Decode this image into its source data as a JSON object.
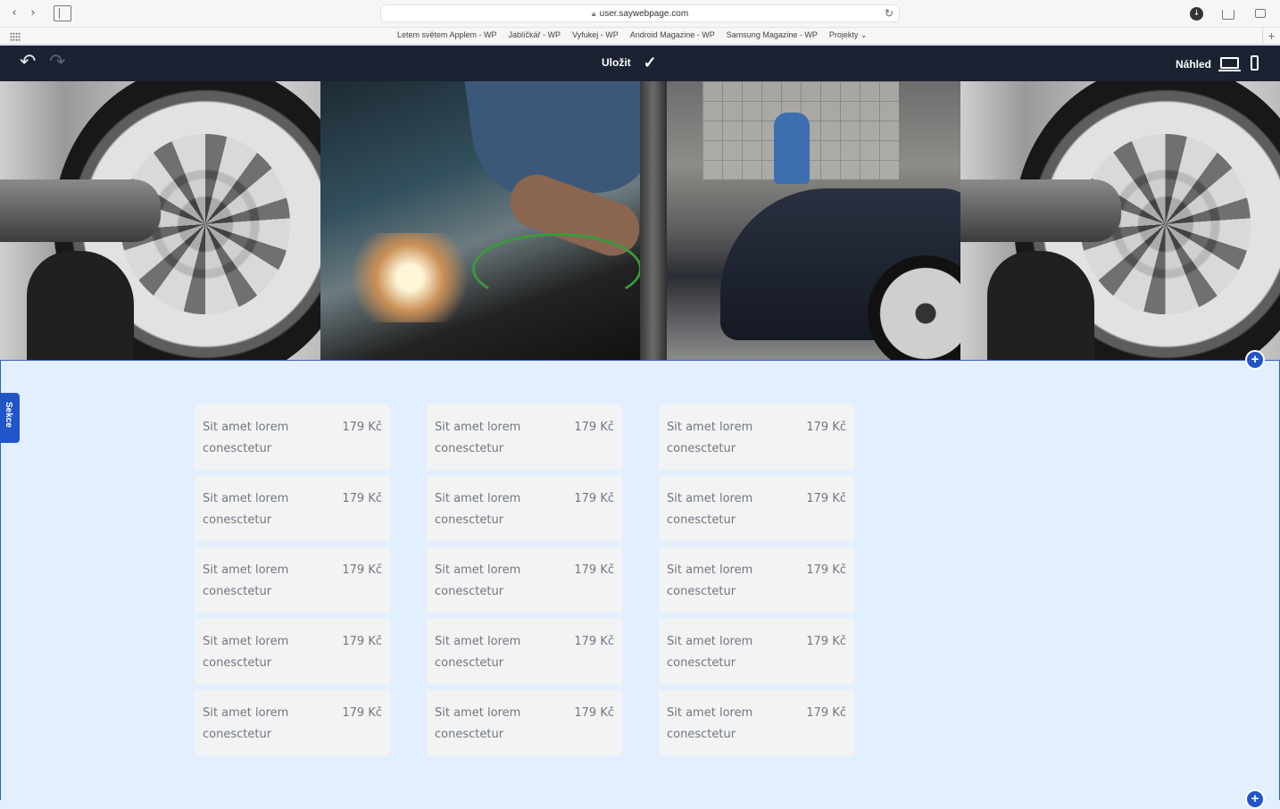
{
  "browser": {
    "url": "user.saywebpage.com",
    "bookmarks": [
      "Letem světem Applem - WP",
      "Jablíčkář - WP",
      "Vyfukej - WP",
      "Android Magazine - WP",
      "Samsung Magazine - WP",
      "Projekty ⌄"
    ]
  },
  "editor": {
    "save_label": "Uložit",
    "preview_label": "Náhled"
  },
  "section": {
    "tab_label": "Sekce"
  },
  "menu": {
    "columns": [
      [
        {
          "name": "Sit amet lorem conesctetur",
          "price": "179 Kč"
        },
        {
          "name": "Sit amet lorem conesctetur",
          "price": "179 Kč"
        },
        {
          "name": "Sit amet lorem conesctetur",
          "price": "179 Kč"
        },
        {
          "name": "Sit amet lorem conesctetur",
          "price": "179 Kč"
        },
        {
          "name": "Sit amet lorem conesctetur",
          "price": "179 Kč"
        }
      ],
      [
        {
          "name": "Sit amet lorem conesctetur",
          "price": "179 Kč"
        },
        {
          "name": "Sit amet lorem conesctetur",
          "price": "179 Kč"
        },
        {
          "name": "Sit amet lorem conesctetur",
          "price": "179 Kč"
        },
        {
          "name": "Sit amet lorem conesctetur",
          "price": "179 Kč"
        },
        {
          "name": "Sit amet lorem conesctetur",
          "price": "179 Kč"
        }
      ],
      [
        {
          "name": "Sit amet lorem conesctetur",
          "price": "179 Kč"
        },
        {
          "name": "Sit amet lorem conesctetur",
          "price": "179 Kč"
        },
        {
          "name": "Sit amet lorem conesctetur",
          "price": "179 Kč"
        },
        {
          "name": "Sit amet lorem conesctetur",
          "price": "179 Kč"
        },
        {
          "name": "Sit amet lorem conesctetur",
          "price": "179 Kč"
        }
      ]
    ]
  },
  "icons": {
    "back": "chevron-left-icon",
    "forward": "chevron-right-icon",
    "undo": "undo-icon",
    "redo": "redo-icon",
    "save": "check-icon",
    "desktop": "desktop-icon",
    "mobile": "mobile-icon",
    "add": "plus-icon"
  },
  "colors": {
    "toolbar": "#1b2231",
    "accent": "#2155c7",
    "section_bg": "#e2efff",
    "card_bg": "#f3f3f3",
    "card_text": "#6f7783"
  }
}
